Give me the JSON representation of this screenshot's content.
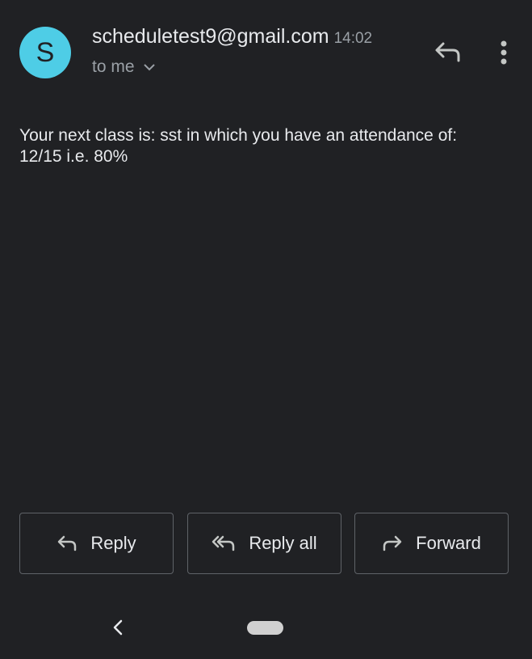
{
  "email": {
    "avatar_letter": "S",
    "sender": "scheduletest9@gmail.com",
    "time": "14:02",
    "recipient": "to me",
    "body_line1": "Your next class is: sst in which you have an attendance of:",
    "body_line2": "12/15 i.e. 80%"
  },
  "actions": {
    "reply_label": "Reply",
    "reply_all_label": "Reply all",
    "forward_label": "Forward"
  },
  "icons": {
    "top_reply": "reply-icon",
    "top_more": "more-vert-icon",
    "recipient_expand": "chevron-down-icon",
    "nav_back": "back-chevron-icon",
    "nav_home": "home-pill"
  },
  "colors": {
    "background": "#202124",
    "avatar": "#4ecde6",
    "text_primary": "#e8eaed",
    "text_secondary": "#9aa0a6",
    "button_border": "#5f6368"
  }
}
